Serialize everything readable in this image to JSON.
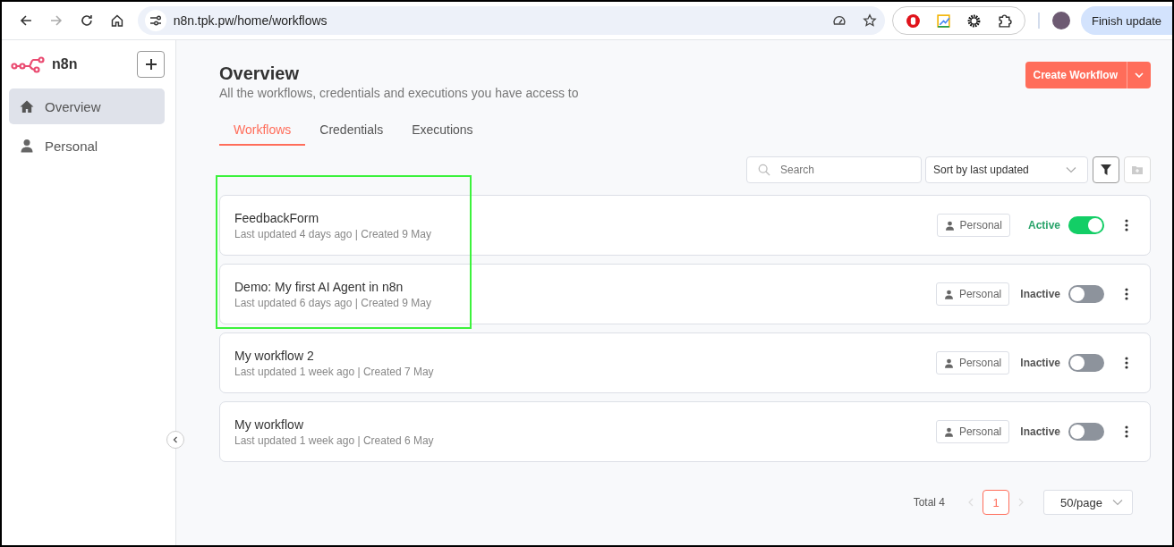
{
  "browser": {
    "url": "n8n.tpk.pw/home/workflows",
    "update_button": "Finish update"
  },
  "sidebar": {
    "logo": "n8n",
    "items": [
      {
        "label": "Overview",
        "selected": true,
        "kind": "home"
      },
      {
        "label": "Personal",
        "selected": false,
        "kind": "user"
      }
    ]
  },
  "header": {
    "title": "Overview",
    "subtitle": "All the workflows, credentials and executions you have access to",
    "create_button": "Create Workflow"
  },
  "tabs": [
    {
      "label": "Workflows",
      "selected": true
    },
    {
      "label": "Credentials",
      "selected": false
    },
    {
      "label": "Executions",
      "selected": false
    }
  ],
  "toolbar": {
    "search_placeholder": "Search",
    "sort": "Sort by last updated"
  },
  "workflows": [
    {
      "name": "FeedbackForm",
      "meta": "Last updated 4 days ago | Created 9 May",
      "project": "Personal",
      "status": "Active",
      "active": true
    },
    {
      "name": "Demo: My first AI Agent in n8n",
      "meta": "Last updated 6 days ago | Created 9 May",
      "project": "Personal",
      "status": "Inactive",
      "active": false
    },
    {
      "name": "My workflow 2",
      "meta": "Last updated 1 week ago | Created 7 May",
      "project": "Personal",
      "status": "Inactive",
      "active": false
    },
    {
      "name": "My workflow",
      "meta": "Last updated 1 week ago | Created 6 May",
      "project": "Personal",
      "status": "Inactive",
      "active": false
    }
  ],
  "pagination": {
    "total": "Total 4",
    "pages": [
      {
        "label": "1",
        "selected": true
      }
    ],
    "page_size": "50/page"
  }
}
